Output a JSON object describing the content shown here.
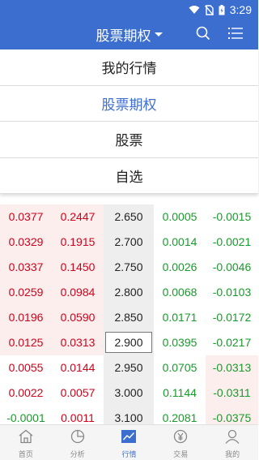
{
  "status_bar": {
    "time": "3:29"
  },
  "header": {
    "title": "股票期权"
  },
  "dropdown": {
    "items": [
      {
        "label": "我的行情",
        "active": false
      },
      {
        "label": "股票期权",
        "active": true
      },
      {
        "label": "股票",
        "active": false
      },
      {
        "label": "自选",
        "active": false
      }
    ]
  },
  "quotes": [
    {
      "c1": "0.0377",
      "c2": "0.2447",
      "strike": "2.650",
      "p1": "0.0005",
      "p2": "-0.0015"
    },
    {
      "c1": "0.0329",
      "c2": "0.1915",
      "strike": "2.700",
      "p1": "0.0014",
      "p2": "-0.0021"
    },
    {
      "c1": "0.0337",
      "c2": "0.1450",
      "strike": "2.750",
      "p1": "0.0026",
      "p2": "-0.0046"
    },
    {
      "c1": "0.0259",
      "c2": "0.0984",
      "strike": "2.800",
      "p1": "0.0068",
      "p2": "-0.0103"
    },
    {
      "c1": "0.0196",
      "c2": "0.0590",
      "strike": "2.850",
      "p1": "0.0171",
      "p2": "-0.0172"
    },
    {
      "c1": "0.0125",
      "c2": "0.0313",
      "strike": "2.900",
      "p1": "0.0395",
      "p2": "-0.0217"
    },
    {
      "c1": "0.0055",
      "c2": "0.0144",
      "strike": "2.950",
      "p1": "0.0705",
      "p2": "-0.0313"
    },
    {
      "c1": "0.0022",
      "c2": "0.0057",
      "strike": "3.000",
      "p1": "0.1144",
      "p2": "-0.0311"
    },
    {
      "c1": "-0.0001",
      "c2": "0.0011",
      "strike": "3.100",
      "p1": "0.2081",
      "p2": "-0.0375"
    }
  ],
  "tabs": [
    {
      "label": "首页",
      "icon": "home-icon",
      "active": false
    },
    {
      "label": "分析",
      "icon": "pie-chart-icon",
      "active": false
    },
    {
      "label": "行情",
      "icon": "trend-chart-icon",
      "active": true
    },
    {
      "label": "交易",
      "icon": "yen-icon",
      "active": false
    },
    {
      "label": "我的",
      "icon": "user-icon",
      "active": false
    }
  ],
  "colors": {
    "primary": "#3c6ed0",
    "up": "#d0021b",
    "down": "#1a9a2c",
    "call_bg_itm": "#fdeeee",
    "put_bg_itm": "#eaf6ec"
  }
}
